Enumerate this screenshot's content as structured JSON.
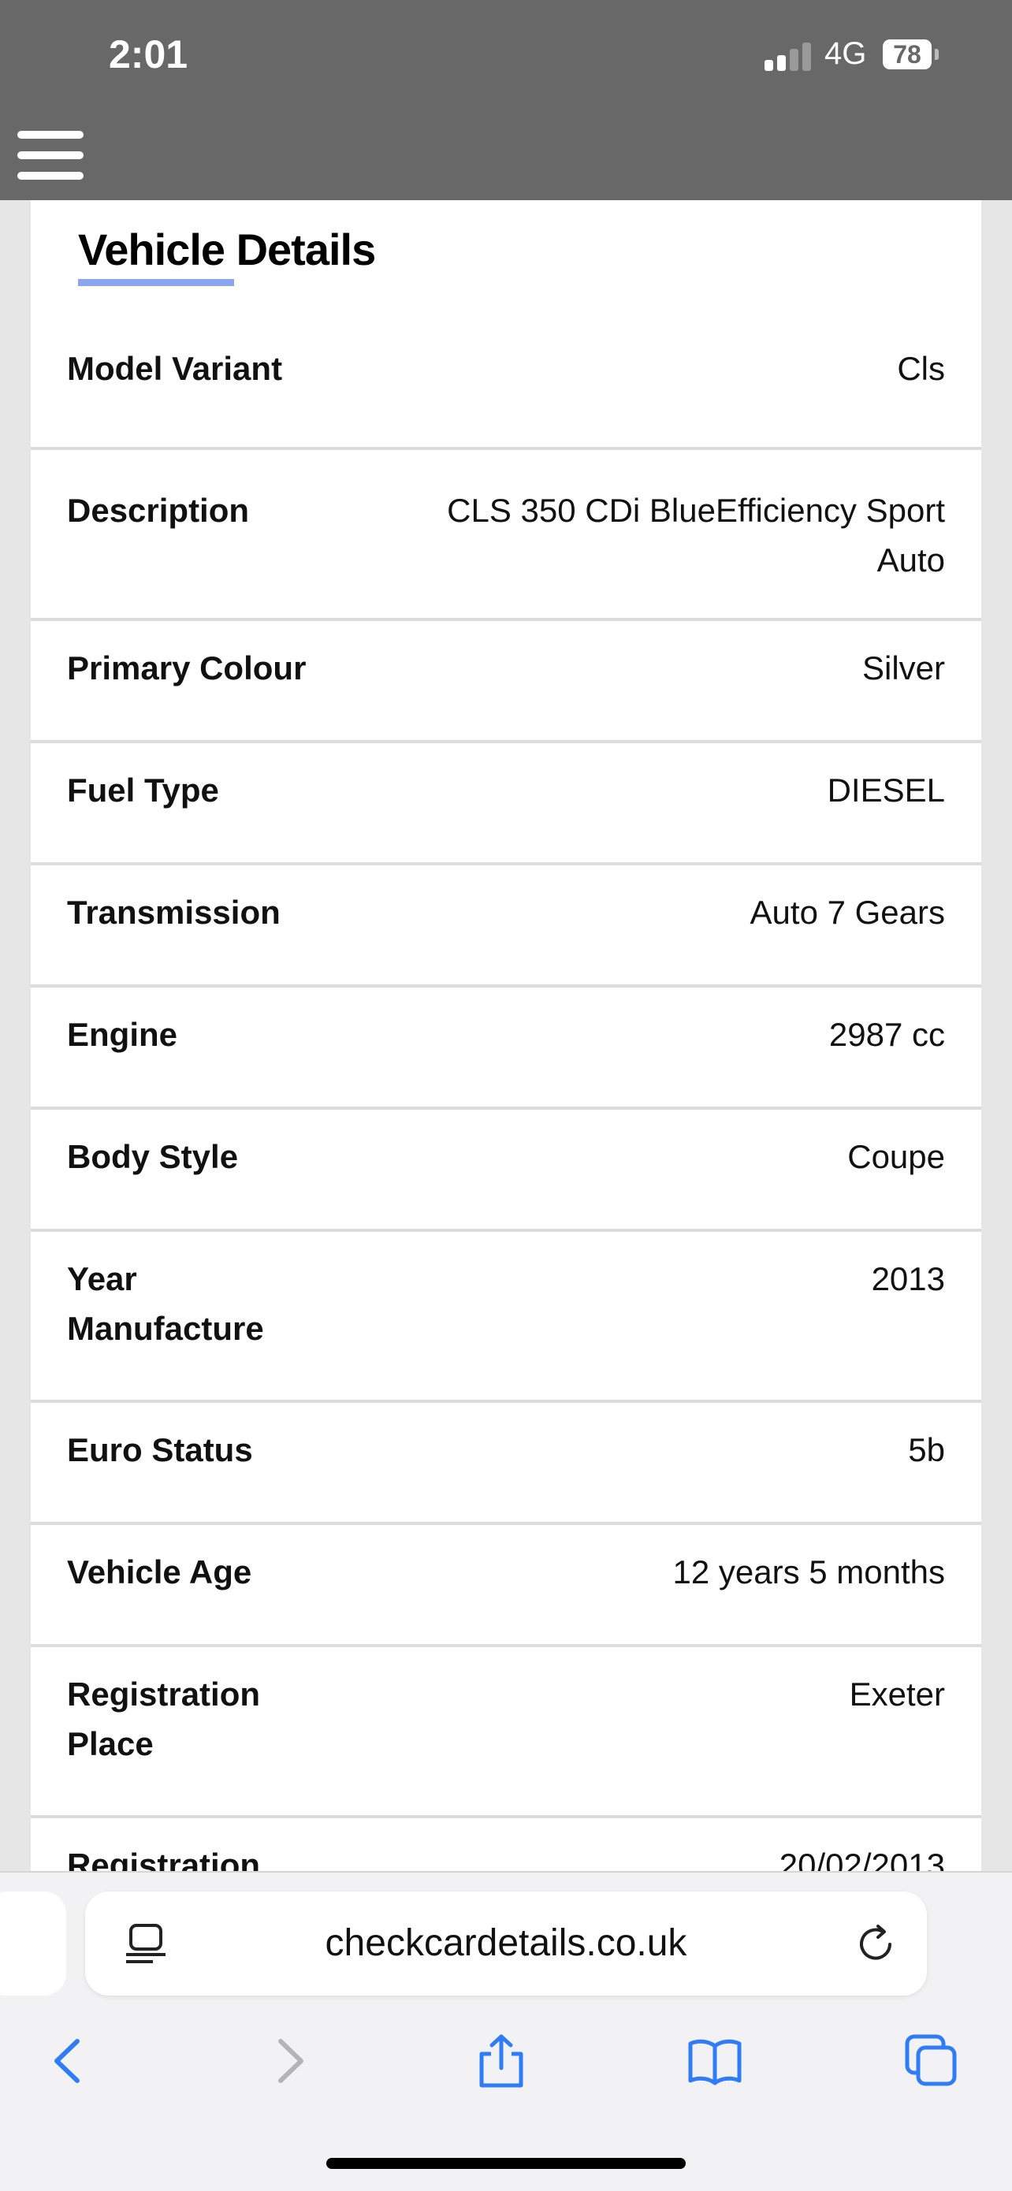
{
  "status_bar": {
    "time": "2:01",
    "network": "4G",
    "battery": "78"
  },
  "card": {
    "title": "Vehicle Details",
    "rows": [
      {
        "label": "Model Variant",
        "value": "Cls"
      },
      {
        "label": "Description",
        "value": "CLS 350 CDi BlueEfficiency Sport Auto"
      },
      {
        "label": "Primary Colour",
        "value": "Silver"
      },
      {
        "label": "Fuel Type",
        "value": "DIESEL"
      },
      {
        "label": "Transmission",
        "value": "Auto 7 Gears"
      },
      {
        "label": "Engine",
        "value": "2987 cc"
      },
      {
        "label": "Body Style",
        "value": "Coupe"
      },
      {
        "label": "Year Manufacture",
        "value": "2013"
      },
      {
        "label": "Euro Status",
        "value": "5b"
      },
      {
        "label": "Vehicle Age",
        "value": "12 years 5 months"
      },
      {
        "label": "Registration Place",
        "value": "Exeter"
      },
      {
        "label": "Registration",
        "value": "20/02/2013"
      }
    ]
  },
  "browser": {
    "url": "checkcardetails.co.uk",
    "accent_color": "#2f7cf6"
  },
  "icons": {
    "menu": "hamburger-menu-icon",
    "page": "page-settings-icon",
    "reload": "reload-icon",
    "back": "back-chevron-icon",
    "forward": "forward-chevron-icon",
    "share": "share-icon",
    "bookmarks": "bookmarks-icon",
    "tabs": "tabs-icon"
  }
}
